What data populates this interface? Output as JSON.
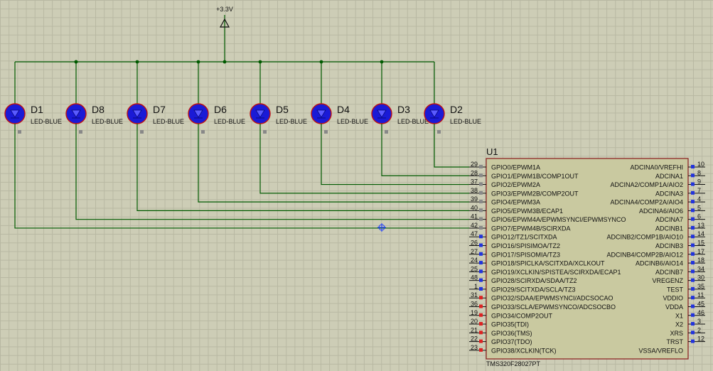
{
  "power": {
    "label": "+3.3V"
  },
  "leds": [
    {
      "ref": "D1",
      "value": "LED-BLUE"
    },
    {
      "ref": "D8",
      "value": "LED-BLUE"
    },
    {
      "ref": "D7",
      "value": "LED-BLUE"
    },
    {
      "ref": "D6",
      "value": "LED-BLUE"
    },
    {
      "ref": "D5",
      "value": "LED-BLUE"
    },
    {
      "ref": "D4",
      "value": "LED-BLUE"
    },
    {
      "ref": "D3",
      "value": "LED-BLUE"
    },
    {
      "ref": "D2",
      "value": "LED-BLUE"
    }
  ],
  "chip": {
    "ref": "U1",
    "part": "TMS320F28027PT",
    "left_pins": [
      {
        "num": "29",
        "name": "GPIO0/EPWM1A"
      },
      {
        "num": "28",
        "name": "GPIO1/EPWM1B/COMP1OUT"
      },
      {
        "num": "37",
        "name": "GPIO2/EPWM2A"
      },
      {
        "num": "38",
        "name": "GPIO3/EPWM2B/COMP2OUT"
      },
      {
        "num": "39",
        "name": "GPIO4/EPWM3A"
      },
      {
        "num": "40",
        "name": "GPIO5/EPWM3B/ECAP1"
      },
      {
        "num": "41",
        "name": "GPIO6/EPWM4A/EPWMSYNCI/EPWMSYNCO"
      },
      {
        "num": "42",
        "name": "GPIO7/EPWM4B/SCIRXDA"
      },
      {
        "num": "47",
        "name": "GPIO12/TZ1/SCITXDA"
      },
      {
        "num": "26",
        "name": "GPIO16/SPISIMOA/TZ2"
      },
      {
        "num": "27",
        "name": "GPIO17/SPISOMIA/TZ3"
      },
      {
        "num": "24",
        "name": "GPIO18/SPICLKA/SCITXDA/XCLKOUT"
      },
      {
        "num": "25",
        "name": "GPIO19/XCLKIN/SPISTEA/SCIRXDA/ECAP1"
      },
      {
        "num": "48",
        "name": "GPIO28/SCIRXDA/SDAA/TZ2"
      },
      {
        "num": "1",
        "name": "GPIO29/SCITXDA/SCLA/TZ3"
      },
      {
        "num": "31",
        "name": "GPIO32/SDAA/EPWMSYNCI/ADCSOCAO"
      },
      {
        "num": "36",
        "name": "GPIO33/SCLA/EPWMSYNCO/ADCSOCBO"
      },
      {
        "num": "19",
        "name": "GPIO34/COMP2OUT"
      },
      {
        "num": "20",
        "name": "GPIO35(TDI)"
      },
      {
        "num": "21",
        "name": "GPIO36(TMS)"
      },
      {
        "num": "22",
        "name": "GPIO37(TDO)"
      },
      {
        "num": "23",
        "name": "GPIO38/XCLKIN(TCK)"
      }
    ],
    "right_pins": [
      {
        "num": "10",
        "name": "ADCINA0/VREFHI"
      },
      {
        "num": "8",
        "name": "ADCINA1"
      },
      {
        "num": "9",
        "name": "ADCINA2/COMP1A/AIO2"
      },
      {
        "num": "7",
        "name": "ADCINA3"
      },
      {
        "num": "4",
        "name": "ADCINA4/COMP2A/AIO4"
      },
      {
        "num": "5",
        "name": "ADCINA6/AIO6"
      },
      {
        "num": "6",
        "name": "ADCINA7"
      },
      {
        "num": "13",
        "name": "ADCINB1"
      },
      {
        "num": "14",
        "name": "ADCINB2/COMP1B/AIO10"
      },
      {
        "num": "15",
        "name": "ADCINB3"
      },
      {
        "num": "17",
        "name": "ADCINB4/COMP2B/AIO12"
      },
      {
        "num": "18",
        "name": "ADCINB6/AIO14"
      },
      {
        "num": "34",
        "name": "ADCINB7"
      },
      {
        "num": "30",
        "name": "VREGENZ"
      },
      {
        "num": "35",
        "name": "TEST"
      },
      {
        "num": "11",
        "name": "VDDIO"
      },
      {
        "num": "45",
        "name": "VDDA"
      },
      {
        "num": "46",
        "name": "X1"
      },
      {
        "num": "3",
        "name": "X2"
      },
      {
        "num": "2",
        "name": "XRS"
      },
      {
        "num": "12",
        "name": "TRST"
      },
      {
        "num": "",
        "name": "VSSA/VREFLO"
      }
    ]
  },
  "colors": {
    "wire": "#005a00",
    "led_fill": "#1a1ad6",
    "led_outline": "#c01010",
    "chip_fill": "#c9c9a0",
    "chip_border": "#8a1a1a",
    "pin_blue": "#2233dd",
    "pin_red": "#dd2222",
    "pin_gray": "#888888"
  }
}
